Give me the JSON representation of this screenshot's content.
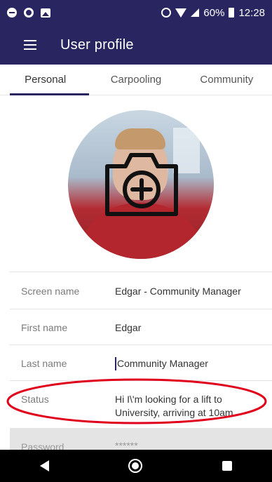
{
  "status_bar": {
    "battery": "60%",
    "time": "12:28",
    "icons": [
      "do-not-disturb-icon",
      "sync-icon",
      "image-icon",
      "alarm-icon",
      "wifi-icon",
      "signal-icon",
      "battery-icon"
    ]
  },
  "app_bar": {
    "title": "User profile",
    "menu_icon": "hamburger-icon"
  },
  "tabs": [
    {
      "label": "Personal",
      "active": true
    },
    {
      "label": "Carpooling",
      "active": false
    },
    {
      "label": "Community",
      "active": false
    }
  ],
  "profile": {
    "photo_overlay_icon": "add-photo-camera-icon"
  },
  "fields": [
    {
      "label": "Screen name",
      "value": "Edgar - Community Manager"
    },
    {
      "label": "First name",
      "value": "Edgar"
    },
    {
      "label": "Last name",
      "value": "Community Manager"
    },
    {
      "label": "Status",
      "value": "Hi I\\'m looking for a lift to University, arriving at 10am"
    },
    {
      "label": "Password",
      "value": "******"
    }
  ],
  "annotation": {
    "color": "#e0001b"
  },
  "nav_bar": {
    "icons": [
      "back-icon",
      "home-icon",
      "recent-apps-icon"
    ]
  },
  "colors": {
    "primary": "#292560",
    "nav_bar": "#000000"
  }
}
